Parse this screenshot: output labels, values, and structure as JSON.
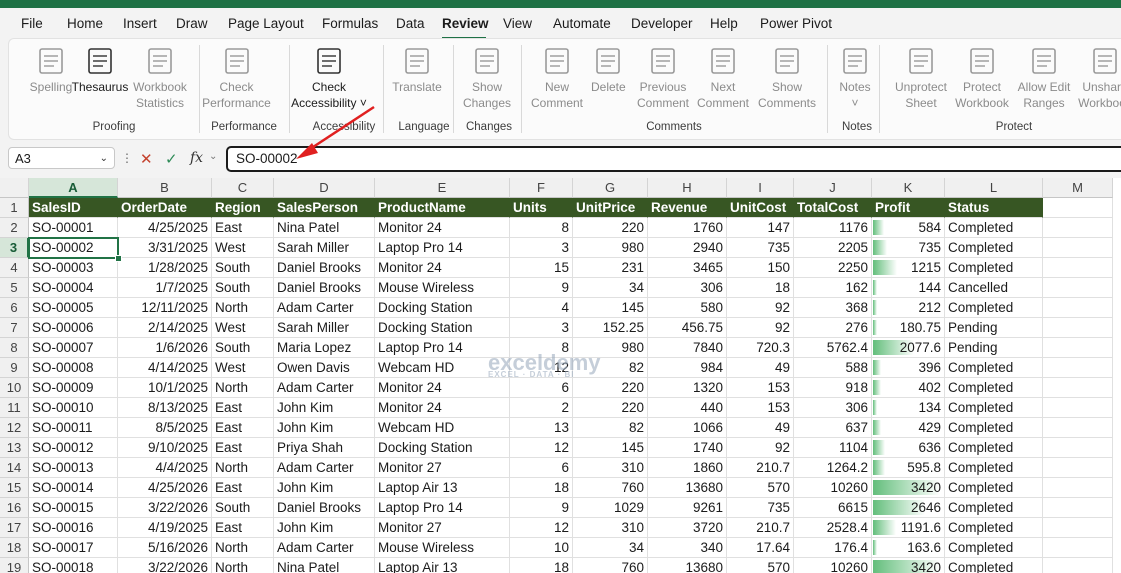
{
  "tabs": [
    "File",
    "Home",
    "Insert",
    "Draw",
    "Page Layout",
    "Formulas",
    "Data",
    "Review",
    "View",
    "Automate",
    "Developer",
    "Help",
    "Power Pivot"
  ],
  "active_tab": "Review",
  "accent_color": "#1e7145",
  "ribbon": {
    "groups": [
      {
        "label": "Proofing",
        "buttons": [
          {
            "label": "Spelling",
            "icon": "spelling-icon"
          },
          {
            "label": "Thesaurus",
            "icon": "thesaurus-icon"
          },
          {
            "label": "Workbook\nStatistics",
            "icon": "workbook-statistics-icon"
          }
        ]
      },
      {
        "label": "Performance",
        "buttons": [
          {
            "label": "Check\nPerformance",
            "icon": "check-performance-icon"
          }
        ]
      },
      {
        "label": "Accessibility",
        "buttons": [
          {
            "label": "Check\nAccessibility ˅",
            "icon": "accessibility-icon"
          }
        ]
      },
      {
        "label": "Language",
        "buttons": [
          {
            "label": "Translate",
            "icon": "translate-icon"
          }
        ]
      },
      {
        "label": "Changes",
        "buttons": [
          {
            "label": "Show\nChanges",
            "icon": "show-changes-icon"
          }
        ]
      },
      {
        "label": "Comments",
        "buttons": [
          {
            "label": "New\nComment",
            "icon": "new-comment-icon"
          },
          {
            "label": "Delete",
            "icon": "delete-comment-icon"
          },
          {
            "label": "Previous\nComment",
            "icon": "previous-comment-icon"
          },
          {
            "label": "Next\nComment",
            "icon": "next-comment-icon"
          },
          {
            "label": "Show\nComments",
            "icon": "show-comments-icon"
          }
        ]
      },
      {
        "label": "Notes",
        "buttons": [
          {
            "label": "Notes\n˅",
            "icon": "notes-icon"
          }
        ]
      },
      {
        "label": "Protect",
        "buttons": [
          {
            "label": "Unprotect\nSheet",
            "icon": "unprotect-sheet-icon"
          },
          {
            "label": "Protect\nWorkbook",
            "icon": "protect-workbook-icon"
          },
          {
            "label": "Allow Edit\nRanges",
            "icon": "allow-edit-ranges-icon"
          },
          {
            "label": "Unshare\nWorkbook",
            "icon": "unshare-workbook-icon"
          }
        ]
      }
    ]
  },
  "formula_bar": {
    "name_box": "A3",
    "fx": "fx",
    "value": "SO-00002"
  },
  "columns": [
    "A",
    "B",
    "C",
    "D",
    "E",
    "F",
    "G",
    "H",
    "I",
    "J",
    "K",
    "L",
    "M"
  ],
  "selected_column": "A",
  "selected_row": 3,
  "headers": [
    "SalesID",
    "OrderDate",
    "Region",
    "SalesPerson",
    "ProductName",
    "Units",
    "UnitPrice",
    "Revenue",
    "UnitCost",
    "TotalCost",
    "Profit",
    "Status"
  ],
  "rows": [
    [
      "SO-00001",
      "4/25/2025",
      "East",
      "Nina Patel",
      "Monitor 24",
      "8",
      "220",
      "1760",
      "147",
      "1176",
      "584",
      "Completed"
    ],
    [
      "SO-00002",
      "3/31/2025",
      "West",
      "Sarah Miller",
      "Laptop Pro 14",
      "3",
      "980",
      "2940",
      "735",
      "2205",
      "735",
      "Completed"
    ],
    [
      "SO-00003",
      "1/28/2025",
      "South",
      "Daniel Brooks",
      "Monitor 24",
      "15",
      "231",
      "3465",
      "150",
      "2250",
      "1215",
      "Completed"
    ],
    [
      "SO-00004",
      "1/7/2025",
      "South",
      "Daniel Brooks",
      "Mouse Wireless",
      "9",
      "34",
      "306",
      "18",
      "162",
      "144",
      "Cancelled"
    ],
    [
      "SO-00005",
      "12/11/2025",
      "North",
      "Adam Carter",
      "Docking Station",
      "4",
      "145",
      "580",
      "92",
      "368",
      "212",
      "Completed"
    ],
    [
      "SO-00006",
      "2/14/2025",
      "West",
      "Sarah Miller",
      "Docking Station",
      "3",
      "152.25",
      "456.75",
      "92",
      "276",
      "180.75",
      "Pending"
    ],
    [
      "SO-00007",
      "1/6/2026",
      "South",
      "Maria Lopez",
      "Laptop Pro 14",
      "8",
      "980",
      "7840",
      "720.3",
      "5762.4",
      "2077.6",
      "Pending"
    ],
    [
      "SO-00008",
      "4/14/2025",
      "West",
      "Owen Davis",
      "Webcam HD",
      "12",
      "82",
      "984",
      "49",
      "588",
      "396",
      "Completed"
    ],
    [
      "SO-00009",
      "10/1/2025",
      "North",
      "Adam Carter",
      "Monitor 24",
      "6",
      "220",
      "1320",
      "153",
      "918",
      "402",
      "Completed"
    ],
    [
      "SO-00010",
      "8/13/2025",
      "East",
      "John Kim",
      "Monitor 24",
      "2",
      "220",
      "440",
      "153",
      "306",
      "134",
      "Completed"
    ],
    [
      "SO-00011",
      "8/5/2025",
      "East",
      "John Kim",
      "Webcam HD",
      "13",
      "82",
      "1066",
      "49",
      "637",
      "429",
      "Completed"
    ],
    [
      "SO-00012",
      "9/10/2025",
      "East",
      "Priya Shah",
      "Docking Station",
      "12",
      "145",
      "1740",
      "92",
      "1104",
      "636",
      "Completed"
    ],
    [
      "SO-00013",
      "4/4/2025",
      "North",
      "Adam Carter",
      "Monitor 27",
      "6",
      "310",
      "1860",
      "210.7",
      "1264.2",
      "595.8",
      "Completed"
    ],
    [
      "SO-00014",
      "4/25/2026",
      "East",
      "John Kim",
      "Laptop Air 13",
      "18",
      "760",
      "13680",
      "570",
      "10260",
      "3420",
      "Completed"
    ],
    [
      "SO-00015",
      "3/22/2026",
      "South",
      "Daniel Brooks",
      "Laptop Pro 14",
      "9",
      "1029",
      "9261",
      "735",
      "6615",
      "2646",
      "Completed"
    ],
    [
      "SO-00016",
      "4/19/2025",
      "East",
      "John Kim",
      "Monitor 27",
      "12",
      "310",
      "3720",
      "210.7",
      "2528.4",
      "1191.6",
      "Completed"
    ],
    [
      "SO-00017",
      "5/16/2026",
      "North",
      "Adam Carter",
      "Mouse Wireless",
      "10",
      "34",
      "340",
      "17.64",
      "176.4",
      "163.6",
      "Completed"
    ],
    [
      "SO-00018",
      "3/22/2026",
      "North",
      "Nina Patel",
      "Laptop Air 13",
      "18",
      "760",
      "13680",
      "570",
      "10260",
      "3420",
      "Completed"
    ]
  ],
  "profit_bar_max": 3420,
  "watermark": {
    "name": "exceldemy",
    "tagline": "EXCEL · DATA · BI"
  }
}
